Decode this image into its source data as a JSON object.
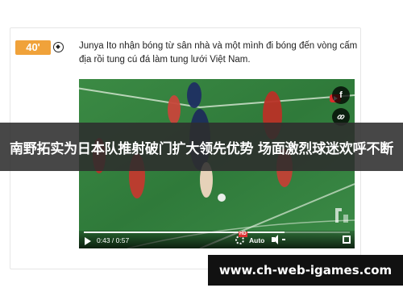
{
  "event": {
    "minute": "40'",
    "icon": "soccer-ball-icon",
    "description": "Junya Ito nhận bóng từ sân nhà và một mình đi bóng đến vòng cấm địa rồi tung cú đá làm tung lưới Việt Nam."
  },
  "video": {
    "share_facebook_label": "f",
    "share_link_icon": "link-icon",
    "time": "0:43 / 0:57",
    "progress": 0.754,
    "hd_label": "HD",
    "quality": "Auto"
  },
  "headline": "南野拓实为日本队推射破门扩大领先优势 场面激烈球迷欢呼不断",
  "site": "www.ch-web-igames.com",
  "colors": {
    "minute_badge": "#f0a23a",
    "pitch": "#2f7a3a",
    "banner": "#2d2d2d"
  }
}
